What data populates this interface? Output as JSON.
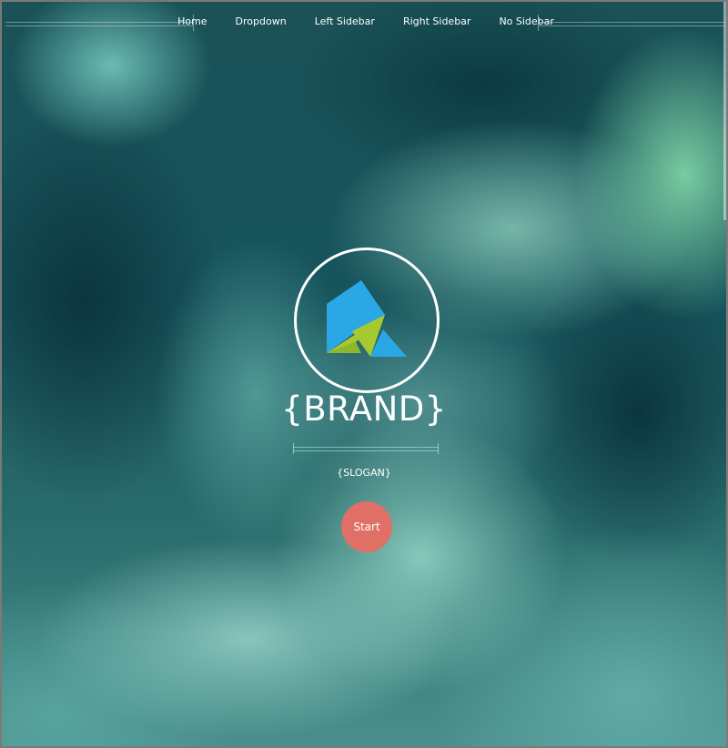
{
  "nav": {
    "items": [
      {
        "label": "Home"
      },
      {
        "label": "Dropdown"
      },
      {
        "label": "Left Sidebar"
      },
      {
        "label": "Right Sidebar"
      },
      {
        "label": "No Sidebar"
      }
    ]
  },
  "hero": {
    "brand": "{BRAND}",
    "slogan": "{SLOGAN}",
    "start_label": "Start",
    "logo_icon": "geometric-mountain-logo"
  },
  "colors": {
    "accent_button": "#e07065",
    "logo_blue": "#2aa8e6",
    "logo_green": "#a8c832",
    "background_dark": "#0e3a44",
    "background_light": "#8fd5c5"
  }
}
